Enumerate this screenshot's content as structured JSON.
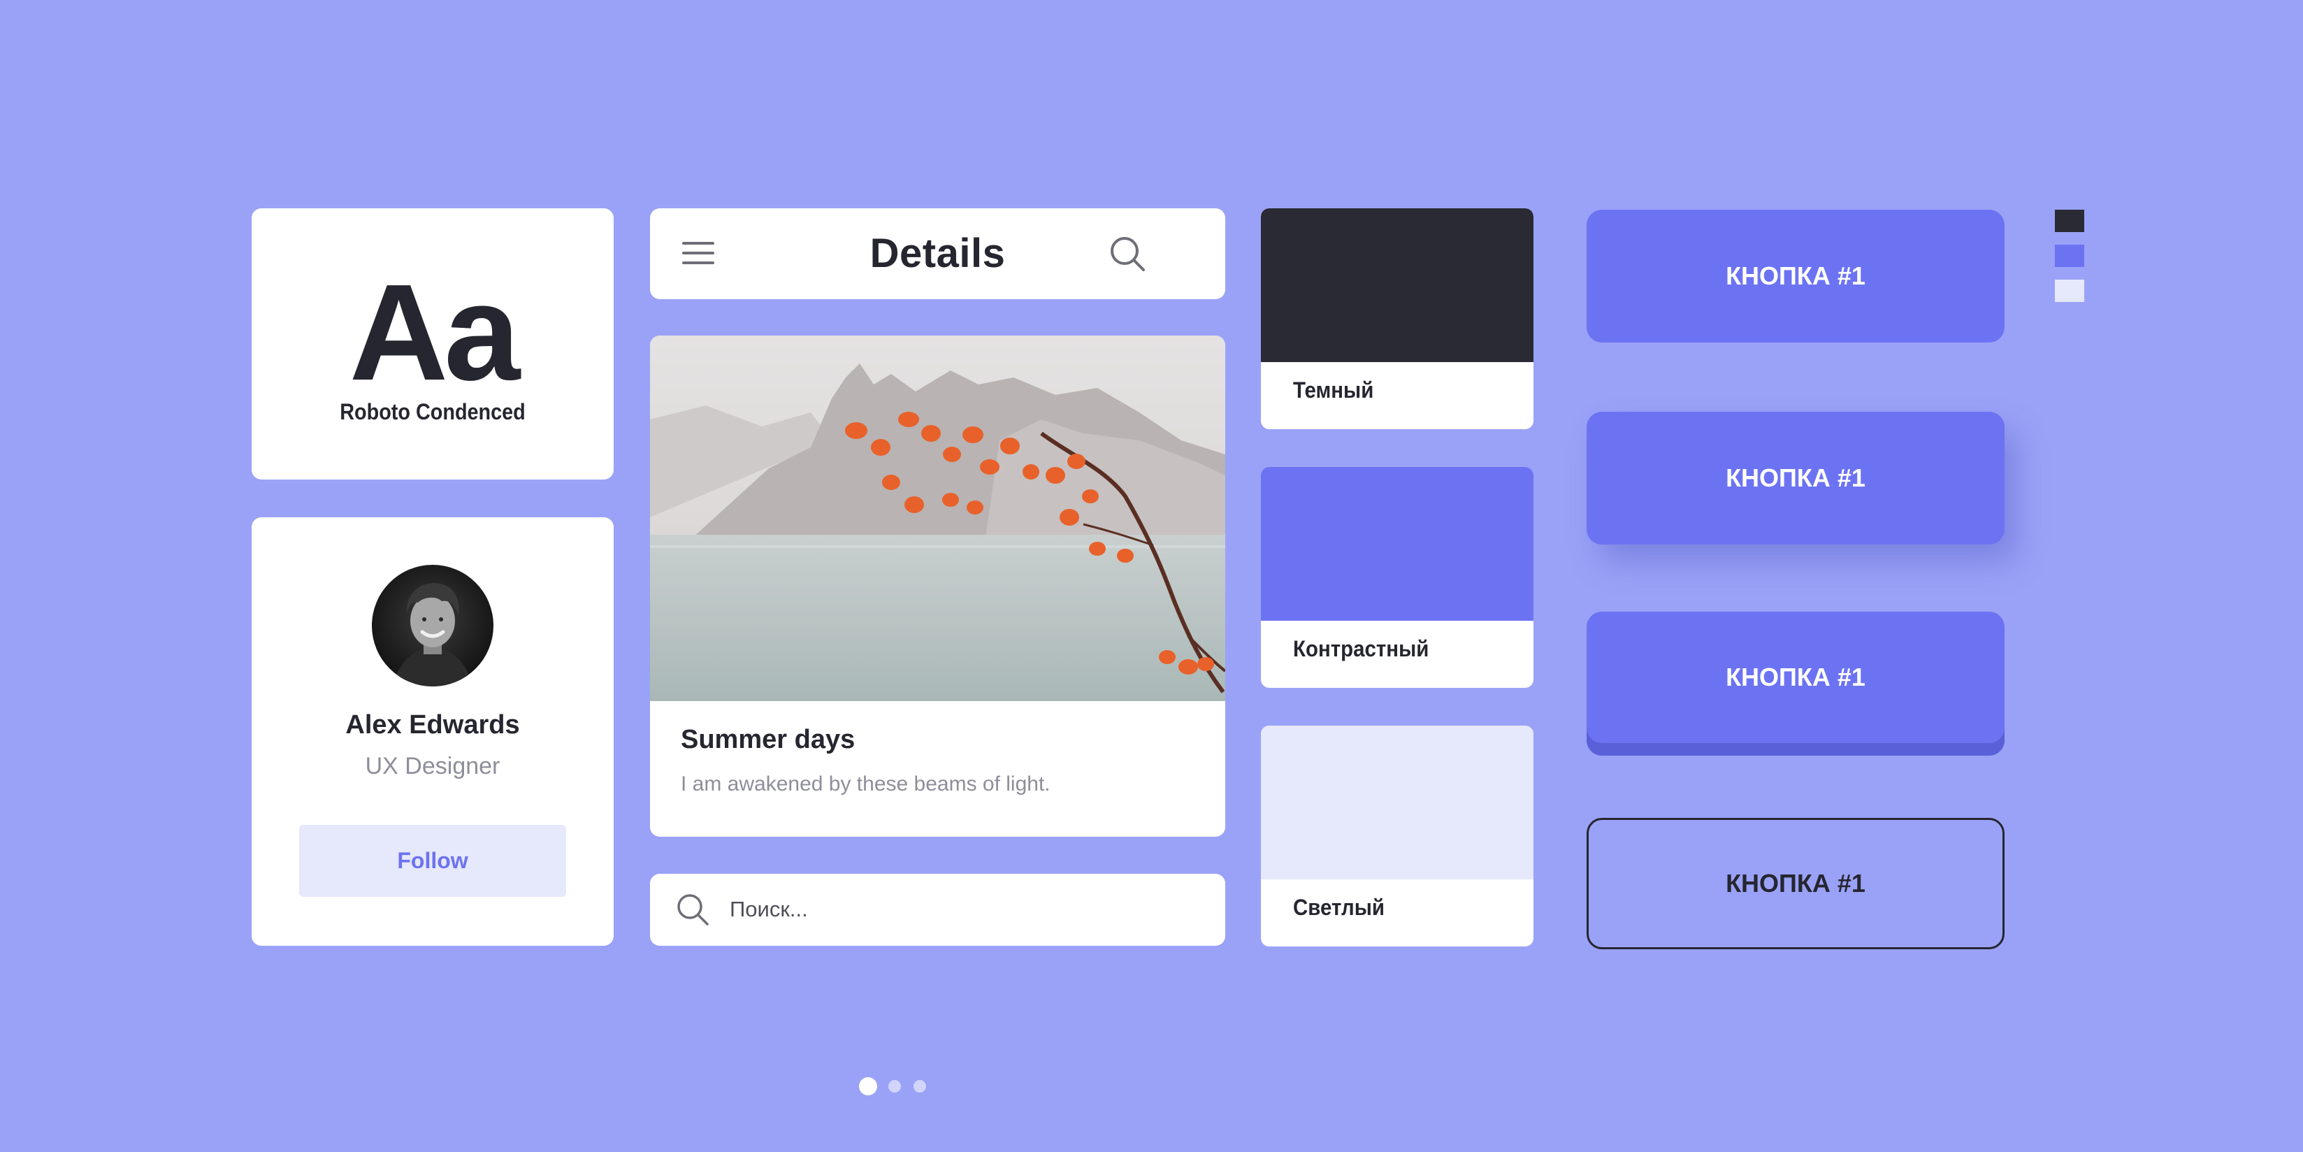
{
  "typography": {
    "sample": "Aa",
    "font_name": "Roboto Condenced"
  },
  "profile": {
    "name": "Alex Edwards",
    "role": "UX Designer",
    "follow_label": "Follow"
  },
  "header": {
    "title": "Details",
    "menu_icon": "hamburger-menu-icon",
    "search_icon": "search-icon"
  },
  "article": {
    "title": "Summer days",
    "description": "I am awakened by these beams of light."
  },
  "search": {
    "placeholder": "Поиск..."
  },
  "swatches": [
    {
      "label": "Темный",
      "color": "#2A2A34"
    },
    {
      "label": "Контрастный",
      "color": "#6C73F2"
    },
    {
      "label": "Светлый",
      "color": "#E6E8FB"
    }
  ],
  "buttons": [
    {
      "label": "КНОПКА #1",
      "style": "filled"
    },
    {
      "label": "КНОПКА #1",
      "style": "shadow"
    },
    {
      "label": "КНОПКА #1",
      "style": "3d"
    },
    {
      "label": "КНОПКА #1",
      "style": "outline"
    }
  ],
  "palette": [
    "#2A2A34",
    "#6C73F2",
    "#E6E8FB"
  ],
  "pagination": {
    "total": 3,
    "active": 1
  },
  "colors": {
    "background": "#9AA2F7",
    "accent": "#6C73F2",
    "dark": "#2A2A34",
    "light": "#E6E8FB",
    "muted_text": "#8E8E9A"
  }
}
